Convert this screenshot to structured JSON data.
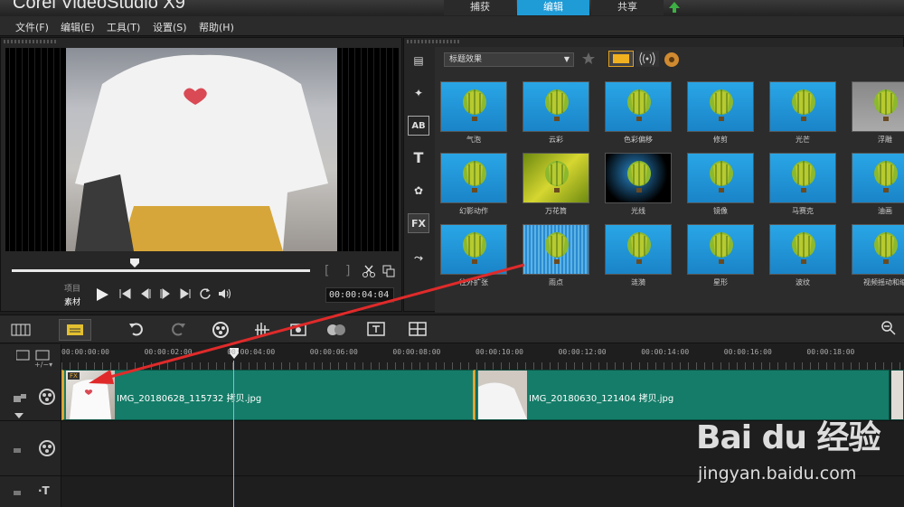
{
  "app": {
    "title": "Corel VideoStudio X9"
  },
  "workspace_tabs": {
    "capture": "捕获",
    "edit": "编辑",
    "share": "共享"
  },
  "menu": {
    "file": "文件(F)",
    "edit": "编辑(E)",
    "tools": "工具(T)",
    "settings": "设置(S)",
    "help": "帮助(H)"
  },
  "preview": {
    "mode_project": "项目",
    "mode_clip": "素材",
    "timecode": "00:00:04:04"
  },
  "library": {
    "category": "标题效果",
    "filters": [
      {
        "label": "气泡"
      },
      {
        "label": "云彩"
      },
      {
        "label": "色彩偏移"
      },
      {
        "label": "修剪"
      },
      {
        "label": "光芒"
      },
      {
        "label": "浮雕"
      },
      {
        "label": "幻影动作"
      },
      {
        "label": "万花筒"
      },
      {
        "label": "光线"
      },
      {
        "label": "镜像"
      },
      {
        "label": "马赛克"
      },
      {
        "label": "油画"
      },
      {
        "label": "往外扩张"
      },
      {
        "label": "雨点"
      },
      {
        "label": "涟漪"
      },
      {
        "label": "星形"
      },
      {
        "label": "波纹"
      },
      {
        "label": "视频摇动和缩"
      }
    ],
    "colors": {
      "accent": "#1f9bd6",
      "thumb_bg": "#29a6e6",
      "selected_border": "#e0a020"
    }
  },
  "timeline": {
    "ruler": [
      "00:00:00:00",
      "00:00:02:00",
      "00:00:04:00",
      "00:00:06:00",
      "00:00:08:00",
      "00:00:10:00",
      "00:00:12:00",
      "00:00:14:00",
      "00:00:16:00",
      "00:00:18:00"
    ],
    "clips": [
      {
        "name": "IMG_20180628_115732 拷贝.jpg",
        "fx": "FX"
      },
      {
        "name": "IMG_20180630_121404 拷贝.jpg"
      }
    ],
    "clip_color": "#147c68"
  },
  "watermark": {
    "logo": "Bai du 经验",
    "url": "jingyan.baidu.com"
  }
}
